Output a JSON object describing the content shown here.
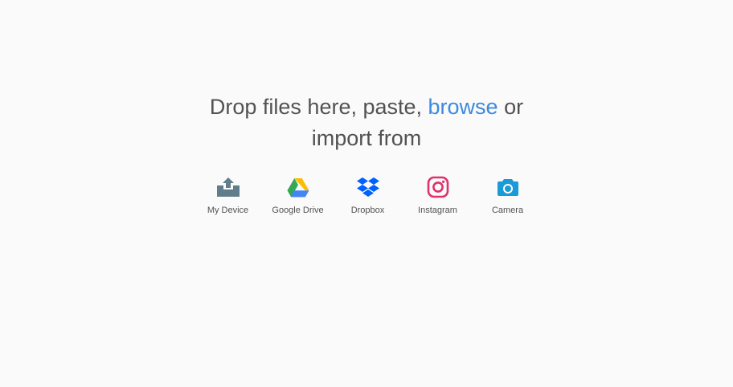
{
  "dropzone": {
    "heading_prefix": "Drop files here, paste, ",
    "browse_label": "browse",
    "heading_suffix_line1": " or",
    "heading_line2": "import from"
  },
  "sources": [
    {
      "label": "My Device",
      "icon": "upload-tray-icon",
      "color": "#607d8b"
    },
    {
      "label": "Google Drive",
      "icon": "google-drive-icon",
      "color": "#34a853"
    },
    {
      "label": "Dropbox",
      "icon": "dropbox-icon",
      "color": "#0061fe"
    },
    {
      "label": "Instagram",
      "icon": "instagram-icon",
      "color": "#e1306c"
    },
    {
      "label": "Camera",
      "icon": "camera-icon",
      "color": "#1a9ad6"
    }
  ],
  "colors": {
    "background": "#fafafa",
    "text": "#525252",
    "link": "#3b8ae0"
  }
}
